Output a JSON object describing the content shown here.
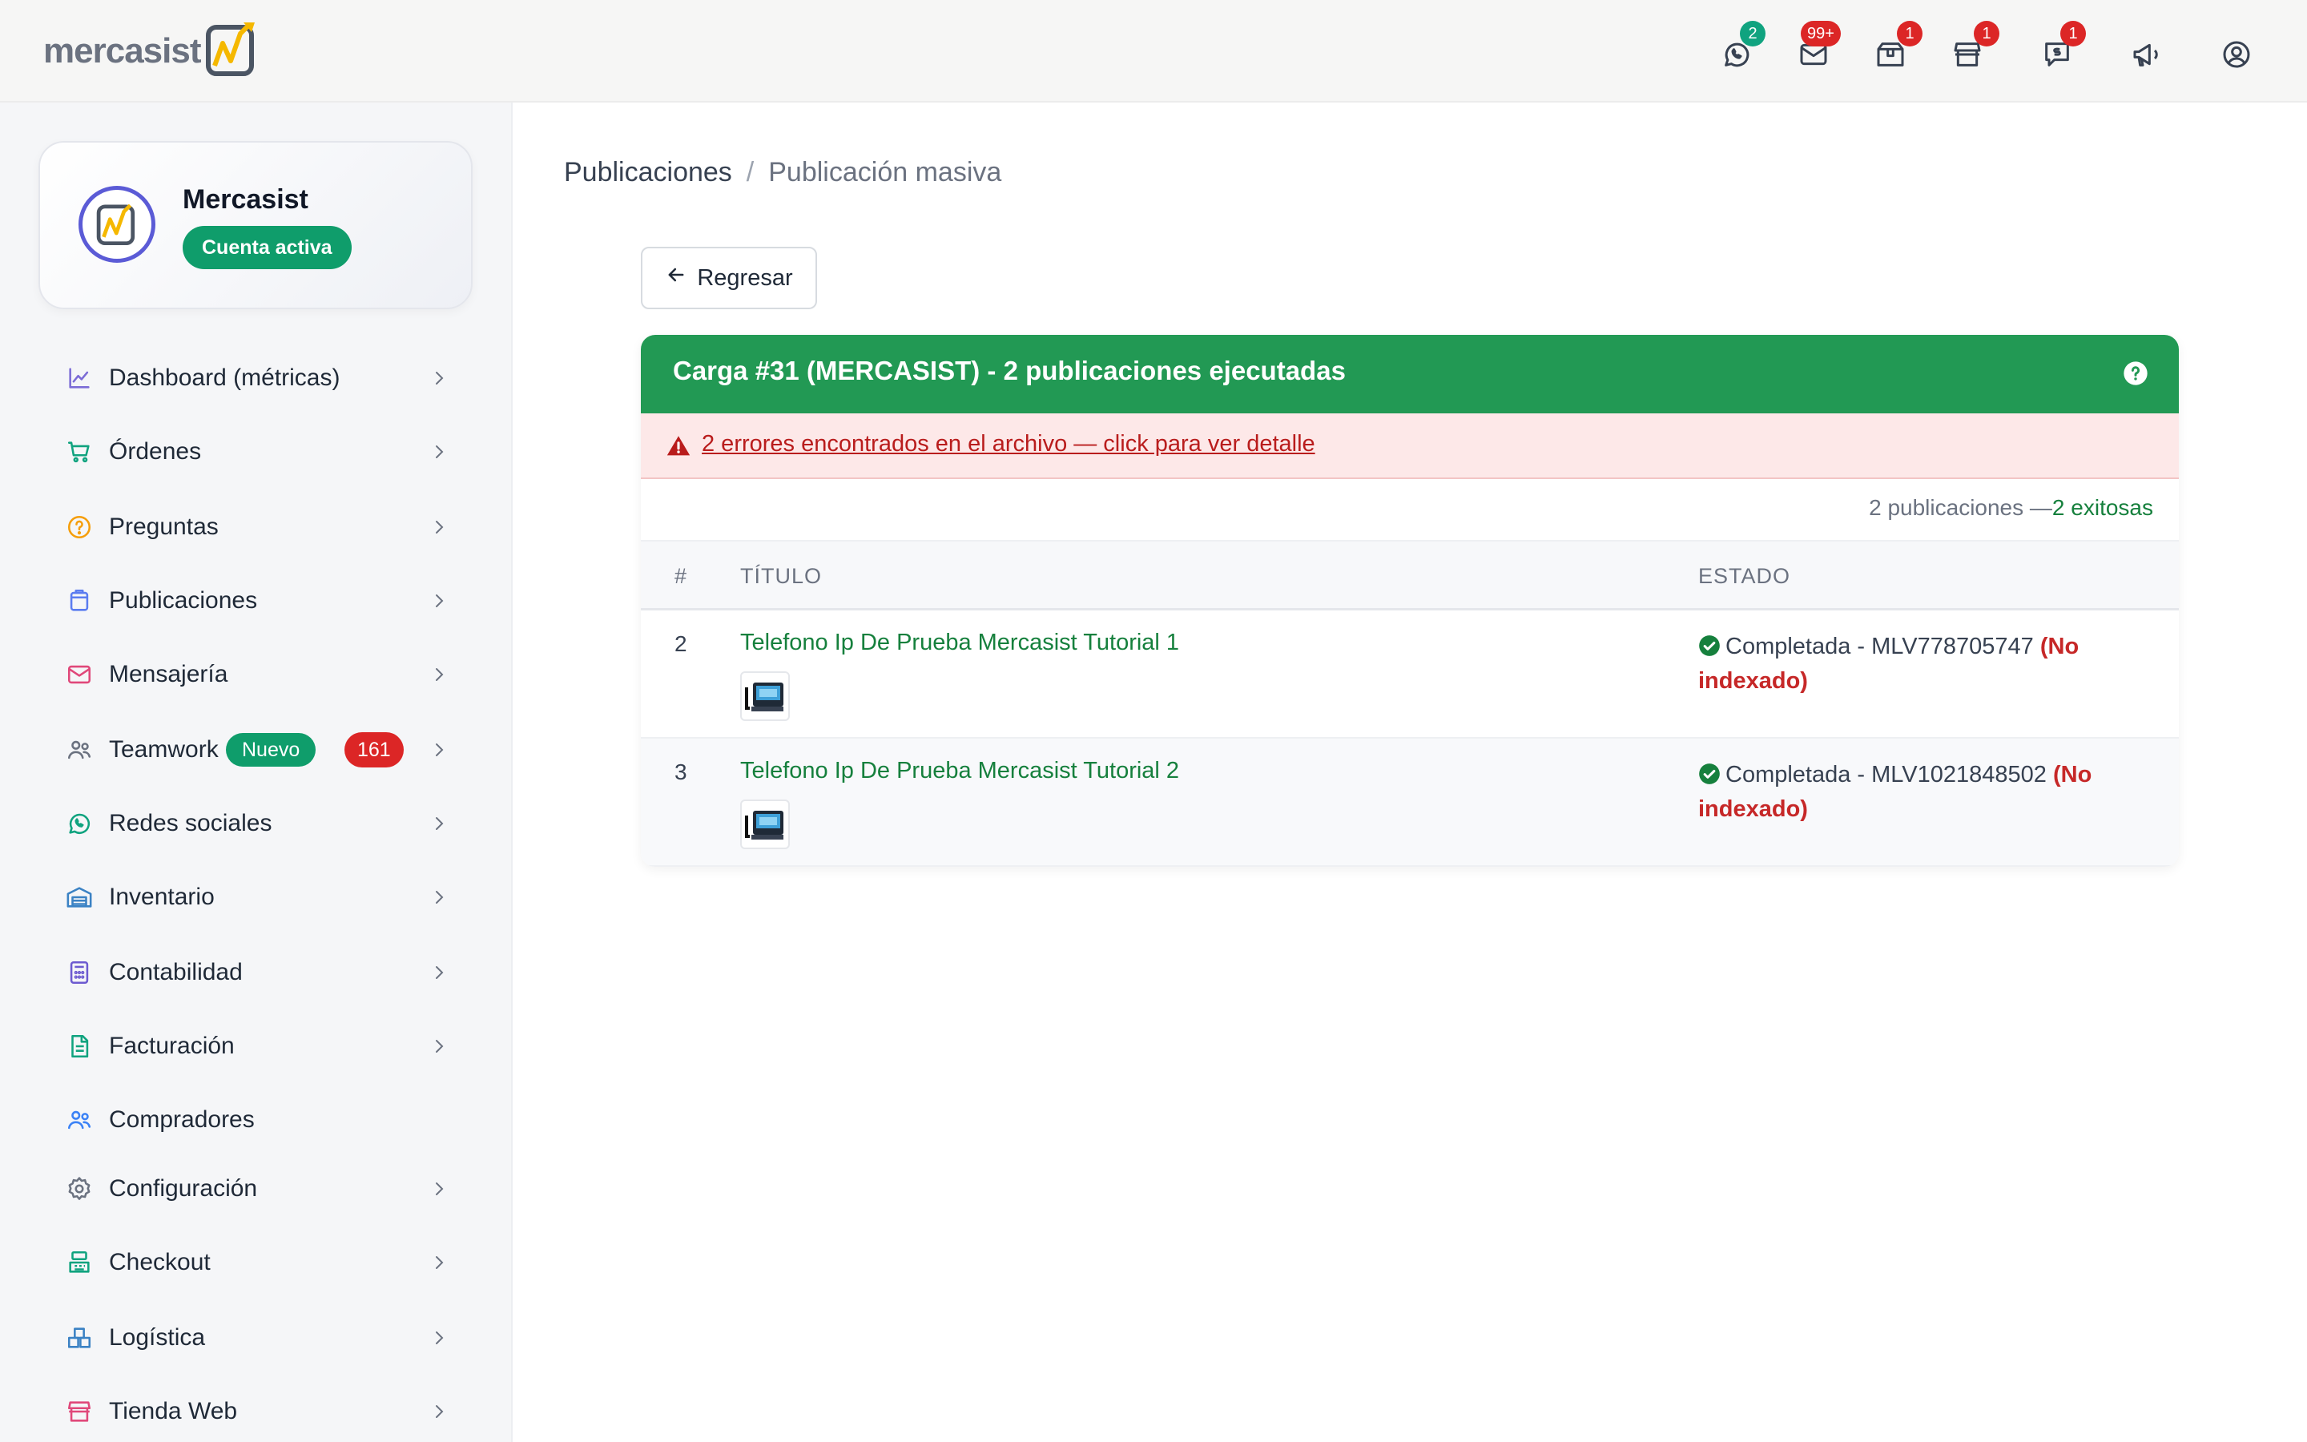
{
  "topbar": {
    "logo_text": "mercasist",
    "icons": [
      {
        "name": "whatsapp-icon",
        "badge": "2",
        "badge_color": "#10a37f"
      },
      {
        "name": "mail-icon",
        "badge": "99+",
        "badge_color": "#dc2626"
      },
      {
        "name": "package-icon",
        "badge": "1",
        "badge_color": "#dc2626"
      },
      {
        "name": "store-icon",
        "badge": "1",
        "badge_color": "#dc2626"
      },
      {
        "name": "money-message-icon",
        "badge": "1",
        "badge_color": "#dc2626"
      },
      {
        "name": "megaphone-icon",
        "badge": "",
        "badge_color": ""
      },
      {
        "name": "user-circle-icon",
        "badge": "",
        "badge_color": ""
      }
    ]
  },
  "profile": {
    "name": "Mercasist",
    "status": "Cuenta activa"
  },
  "sidebar": {
    "items": [
      {
        "label": "Dashboard (métricas)",
        "icon": "chart-line-icon",
        "icon_color": "#7c6cd6",
        "has_chevron": true
      },
      {
        "label": "Órdenes",
        "icon": "cart-icon",
        "icon_color": "#10a37f",
        "has_chevron": true
      },
      {
        "label": "Preguntas",
        "icon": "question-circle-icon",
        "icon_color": "#f59e0b",
        "has_chevron": true
      },
      {
        "label": "Publicaciones",
        "icon": "bag-icon",
        "icon_color": "#5b7cf0",
        "has_chevron": true
      },
      {
        "label": "Mensajería",
        "icon": "mail-icon",
        "icon_color": "#e0487a",
        "has_chevron": true
      },
      {
        "label": "Teamwork",
        "icon": "team-icon",
        "icon_color": "#6b7280",
        "has_chevron": true,
        "badge_new": "Nuevo",
        "badge_count": "161"
      },
      {
        "label": "Redes sociales",
        "icon": "whatsapp-icon",
        "icon_color": "#10a37f",
        "has_chevron": true
      },
      {
        "label": "Inventario",
        "icon": "warehouse-icon",
        "icon_color": "#3b82c4",
        "has_chevron": true
      },
      {
        "label": "Contabilidad",
        "icon": "calculator-icon",
        "icon_color": "#6d5bd0",
        "has_chevron": true
      },
      {
        "label": "Facturación",
        "icon": "invoice-icon",
        "icon_color": "#10a37f",
        "has_chevron": true
      },
      {
        "label": "Compradores",
        "icon": "buyers-icon",
        "icon_color": "#3b82f6",
        "has_chevron": false
      },
      {
        "label": "Configuración",
        "icon": "gear-icon",
        "icon_color": "#6b7280",
        "has_chevron": true
      },
      {
        "label": "Checkout",
        "icon": "register-icon",
        "icon_color": "#10a37f",
        "has_chevron": true
      },
      {
        "label": "Logística",
        "icon": "boxes-icon",
        "icon_color": "#3b82c4",
        "has_chevron": true
      },
      {
        "label": "Tienda Web",
        "icon": "shop-icon",
        "icon_color": "#e0487a",
        "has_chevron": true
      }
    ]
  },
  "breadcrumb": {
    "parent": "Publicaciones",
    "separator": "/",
    "current": "Publicación masiva"
  },
  "back_button": {
    "label": "Regresar"
  },
  "card": {
    "title": "Carga #31 (MERCASIST) - 2 publicaciones ejecutadas",
    "header_color": "#229954",
    "error_text": "2 errores encontrados en el archivo — click para ver detalle",
    "summary_total": "2 publicaciones —",
    "summary_ok": "2 exitosas",
    "columns": [
      "#",
      "TÍTULO",
      "ESTADO"
    ],
    "rows": [
      {
        "num": "2",
        "title": "Telefono Ip De Prueba Mercasist Tutorial 1",
        "status": "Completada - MLV778705747",
        "note": "(No indexado)"
      },
      {
        "num": "3",
        "title": "Telefono Ip De Prueba Mercasist Tutorial 2",
        "status": "Completada - MLV1021848502",
        "note": "(No indexado)"
      }
    ]
  }
}
